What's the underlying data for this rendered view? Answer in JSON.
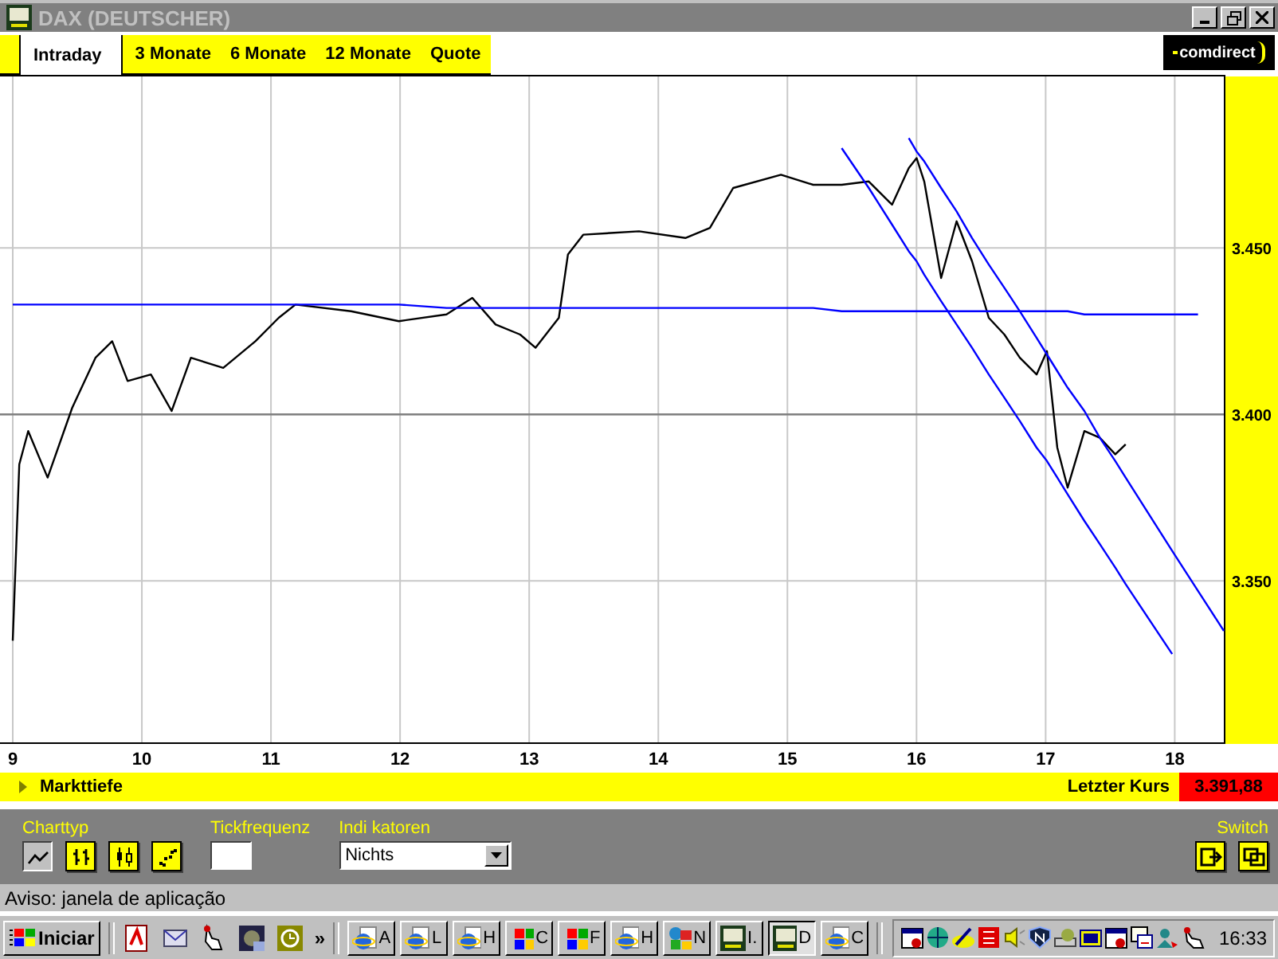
{
  "window": {
    "title": "DAX (DEUTSCHER)"
  },
  "tabs": [
    {
      "label": "Intraday",
      "selected": true
    },
    {
      "label": "3 Monate",
      "selected": false
    },
    {
      "label": "6 Monate",
      "selected": false
    },
    {
      "label": "12 Monate",
      "selected": false
    },
    {
      "label": "Quote",
      "selected": false
    }
  ],
  "brand": {
    "logo_text": "comdirect"
  },
  "chart": {
    "chart_data": {
      "type": "line",
      "x": [
        9.0,
        9.05,
        9.12,
        9.27,
        9.46,
        9.64,
        9.77,
        9.89,
        10.07,
        10.23,
        10.38,
        10.63,
        10.88,
        11.06,
        11.19,
        11.62,
        11.99,
        12.36,
        12.56,
        12.74,
        12.93,
        13.05,
        13.23,
        13.3,
        13.42,
        13.85,
        14.21,
        14.4,
        14.58,
        14.95,
        15.2,
        15.42,
        15.63,
        15.81,
        15.94,
        16.0,
        16.06,
        16.19,
        16.31,
        16.43,
        16.56,
        16.68,
        16.8,
        16.93,
        17.01,
        17.09,
        17.17,
        17.3,
        17.42,
        17.54,
        17.62,
        17.98,
        18.18,
        18.38
      ],
      "series": [
        {
          "color": "#000000",
          "values": [
            3332,
            3385,
            3395,
            3381,
            3402,
            3417,
            3422,
            3410,
            3412,
            3401,
            3417,
            3414,
            3422,
            3429,
            3433,
            3431,
            3428,
            3430,
            3435,
            3427,
            3424,
            3420,
            3429,
            3448,
            3454,
            3455,
            3453,
            3456,
            3468,
            3472,
            3469,
            3469,
            3470,
            3463,
            3474,
            3477,
            3470,
            3441,
            3458,
            3446,
            3429,
            3424,
            3417,
            3412,
            3419,
            3390,
            3378,
            3395,
            3393,
            3388,
            3391,
            null,
            null,
            null
          ]
        },
        {
          "color": "#0000ff",
          "values": [
            3433,
            3433,
            3433,
            3433,
            3433,
            3433,
            3433,
            3433,
            3433,
            3433,
            3433,
            3433,
            3433,
            3433,
            3433,
            3433,
            3433,
            3432,
            3432,
            3432,
            3432,
            3432,
            3432,
            3432,
            3432,
            3432,
            3432,
            3432,
            3432,
            3432,
            3432,
            3431,
            3431,
            3431,
            3431,
            3431,
            3431,
            3431,
            3431,
            3431,
            3431,
            3431,
            3431,
            3431,
            3431,
            3431,
            3431,
            3430,
            3430,
            3430,
            3430,
            3430,
            3430,
            null
          ]
        },
        {
          "color": "#0000ff",
          "values": [
            null,
            null,
            null,
            null,
            null,
            null,
            null,
            null,
            null,
            null,
            null,
            null,
            null,
            null,
            null,
            null,
            null,
            null,
            null,
            null,
            null,
            null,
            null,
            null,
            null,
            null,
            null,
            null,
            null,
            null,
            null,
            3480,
            3468,
            3457,
            3449,
            3446,
            3442,
            3434,
            3427,
            3420,
            3412,
            3405,
            3398,
            3390,
            3386,
            3381,
            3376,
            3368,
            3361,
            3354,
            3349,
            3328,
            null,
            null
          ]
        },
        {
          "color": "#0000ff",
          "values": [
            null,
            null,
            null,
            null,
            null,
            null,
            null,
            null,
            null,
            null,
            null,
            null,
            null,
            null,
            null,
            null,
            null,
            null,
            null,
            null,
            null,
            null,
            null,
            null,
            null,
            null,
            null,
            null,
            null,
            null,
            null,
            null,
            null,
            null,
            3483,
            3479,
            3476,
            3468,
            3461,
            3453,
            3445,
            3438,
            3431,
            3423,
            3418,
            3413,
            3408,
            3401,
            3393,
            3386,
            3381,
            3359,
            3347,
            3335
          ]
        }
      ],
      "xlim": [
        9,
        18.38
      ],
      "ylim": [
        3301,
        3502
      ],
      "xticks": [
        9,
        10,
        11,
        12,
        13,
        14,
        15,
        16,
        17,
        18
      ],
      "yticks": [
        {
          "value": 3350,
          "label": "3.350"
        },
        {
          "value": 3400,
          "label": "3.400"
        },
        {
          "value": 3450,
          "label": "3.450"
        }
      ],
      "grid": true,
      "ref_lines": [
        {
          "axis": "y",
          "value": 3400
        }
      ]
    }
  },
  "info_bar": {
    "label": "Markttiefe",
    "last_price_label": "Letzter Kurs",
    "last_price": "3.391,88"
  },
  "controls": {
    "charttyp": {
      "label": "Charttyp",
      "types": [
        {
          "kind": "line",
          "selected": true
        },
        {
          "kind": "ohlc",
          "selected": false
        },
        {
          "kind": "candle",
          "selected": false
        },
        {
          "kind": "point",
          "selected": false
        }
      ]
    },
    "tickfrequenz": {
      "label": "Tickfrequenz"
    },
    "indikatoren": {
      "label": "Indi katoren",
      "value": "Nichts"
    },
    "switch": {
      "label": "Switch"
    }
  },
  "status_bar": "Aviso: janela de aplicação",
  "taskbar": {
    "start": "Iniciar",
    "more": "»",
    "tasks": [
      {
        "kind": "ie",
        "label": "A",
        "selected": false
      },
      {
        "kind": "ie",
        "label": "L",
        "selected": false
      },
      {
        "kind": "ie",
        "label": "H",
        "selected": false
      },
      {
        "kind": "win",
        "label": "C",
        "selected": false
      },
      {
        "kind": "win",
        "label": "F",
        "selected": false
      },
      {
        "kind": "ie",
        "label": "H",
        "selected": false
      },
      {
        "kind": "puzzle",
        "label": "N",
        "selected": false
      },
      {
        "kind": "tm",
        "label": "I.",
        "selected": false
      },
      {
        "kind": "tm",
        "label": "D",
        "selected": true
      },
      {
        "kind": "ie",
        "label": "C",
        "selected": false
      }
    ],
    "clock": "16:33"
  }
}
